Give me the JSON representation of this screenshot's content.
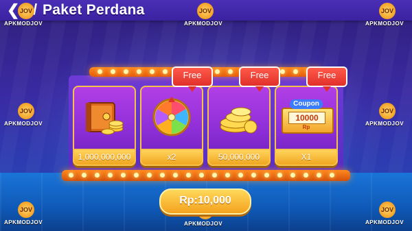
{
  "header": {
    "back_icon": "back-arrow-icon",
    "title": "Paket Perdana"
  },
  "watermark": {
    "badge": "JOV",
    "text": "APKMODJOV"
  },
  "cards": [
    {
      "icon": "treasure-safe-icon",
      "label": "1,000,000,000",
      "free": ""
    },
    {
      "icon": "lucky-wheel-icon",
      "label": "x2",
      "free": "Free"
    },
    {
      "icon": "gold-coins-icon",
      "label": "50,000,000",
      "free": "Free"
    },
    {
      "icon": "coupon-icon",
      "label": "X1",
      "free": "Free",
      "coupon_title": "Coupon",
      "coupon_value": "10000",
      "coupon_unit": "Rp"
    }
  ],
  "price_button": {
    "label": "Rp:10,000"
  }
}
